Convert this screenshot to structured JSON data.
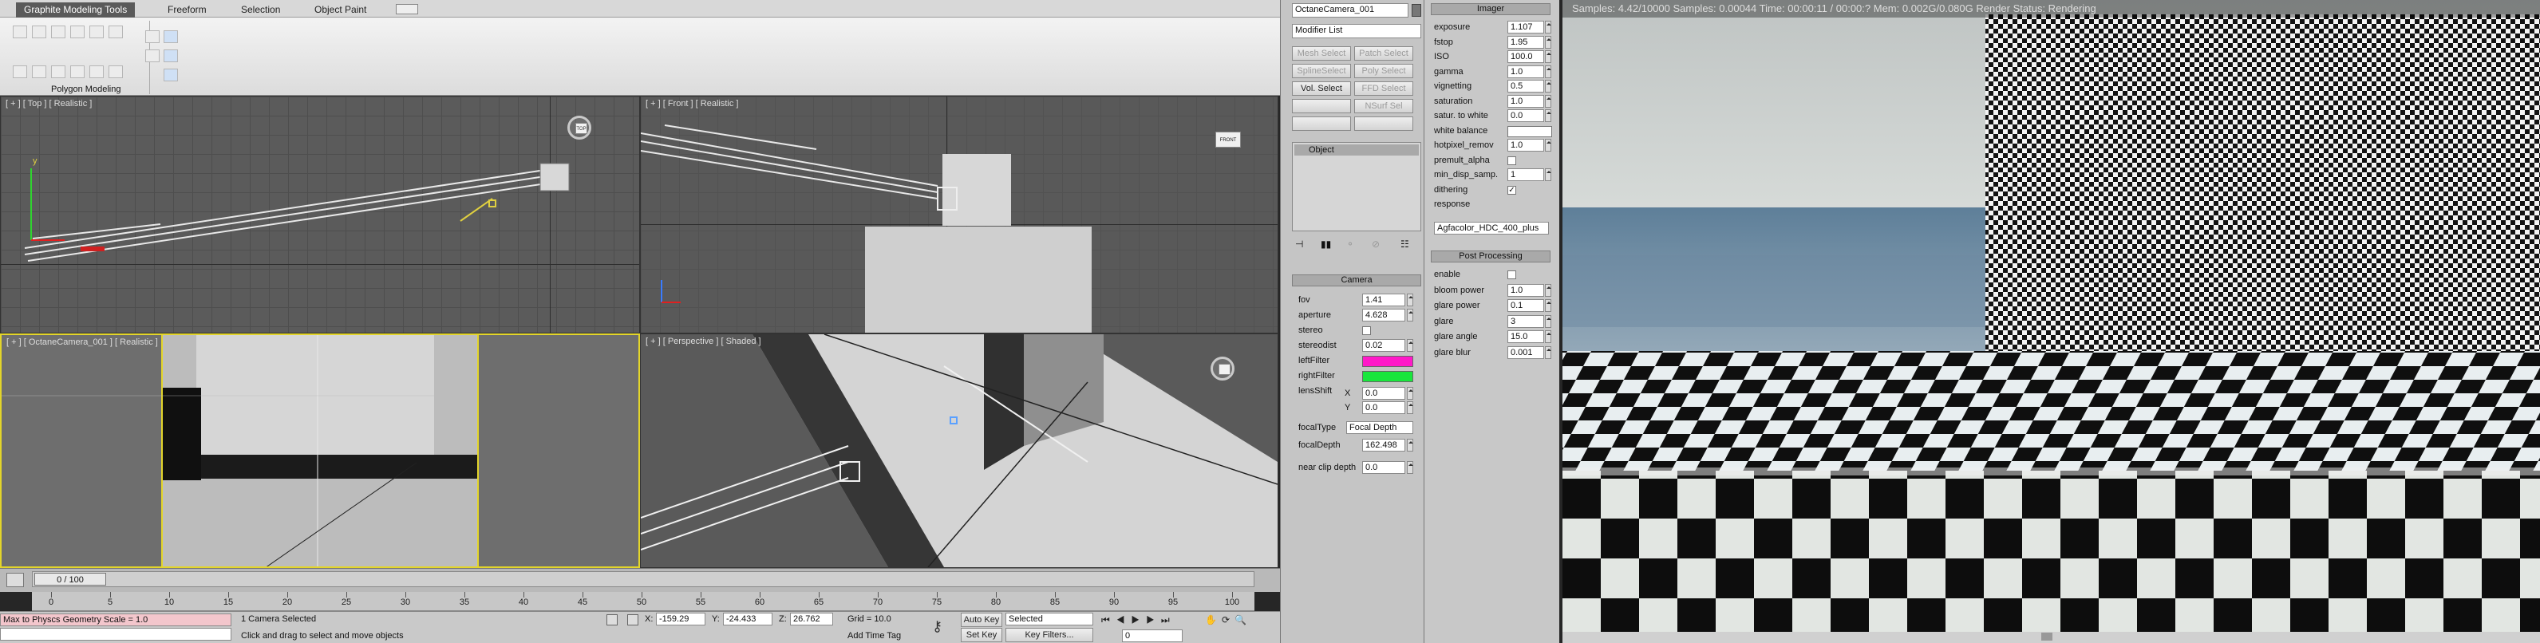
{
  "ribbon": {
    "tabs": [
      "Graphite Modeling Tools",
      "Freeform",
      "Selection",
      "Object Paint"
    ],
    "panel_label": "Polygon Modeling"
  },
  "viewports": {
    "top": "[ + ] [ Top ] [ Realistic ]",
    "front": "[ + ] [ Front ] [ Realistic ]",
    "camera": "[ + ] [ OctaneCamera_001 ] [ Realistic ]",
    "perspective": "[ + ] [ Perspective ] [ Shaded ]",
    "cube_top": "TOP",
    "cube_front": "FRONT",
    "axes": {
      "x": "x",
      "y": "y",
      "z": "z"
    }
  },
  "timeline": {
    "frame_counter": "0 / 100",
    "ticks": [
      "0",
      "5",
      "10",
      "15",
      "20",
      "25",
      "30",
      "35",
      "40",
      "45",
      "50",
      "55",
      "60",
      "65",
      "70",
      "75",
      "80",
      "85",
      "90",
      "95",
      "100"
    ]
  },
  "status": {
    "script_text": "Max to Physcs Geometry Scale = 1.0",
    "selection_text": "1 Camera Selected",
    "prompt_text": "Click and drag to select and move objects",
    "x_label": "X:",
    "x_value": "-159.29",
    "y_label": "Y:",
    "y_value": "-24.433",
    "z_label": "Z:",
    "z_value": "26.762",
    "grid": "Grid = 10.0",
    "add_time_tag": "Add Time Tag",
    "auto_key": "Auto Key",
    "set_key": "Set Key",
    "key_mode": "Selected",
    "key_filters": "Key Filters...",
    "frame_value": "0"
  },
  "command_panel": {
    "object_name": "OctaneCamera_001",
    "modifier_list": "Modifier List",
    "buttons": [
      "Mesh Select",
      "Patch Select",
      "SplineSelect",
      "Poly Select",
      "Vol. Select",
      "FFD Select",
      "",
      "NSurf Sel",
      "",
      ""
    ],
    "stack_item": "Object",
    "camera_rollout": "Camera",
    "params": [
      {
        "label": "fov",
        "value": "1.41"
      },
      {
        "label": "aperture",
        "value": "4.628"
      },
      {
        "label": "stereo",
        "value": ""
      },
      {
        "label": "stereodist",
        "value": "0.02"
      },
      {
        "label": "leftFilter",
        "value": ""
      },
      {
        "label": "rightFilter",
        "value": ""
      },
      {
        "label": "lensShift",
        "value": ""
      }
    ],
    "lens_x_label": "X",
    "lens_x": "0.0",
    "lens_y_label": "Y",
    "lens_y": "0.0",
    "focal_type_label": "focalType",
    "focal_type": "Focal Depth",
    "focal_depth_label": "focalDepth",
    "focal_depth": "162.498",
    "near_clip_label": "near clip depth",
    "near_clip": "0.0",
    "colors": {
      "left_filter": "#ff19c8",
      "right_filter": "#19e63c"
    }
  },
  "imager": {
    "title": "Imager",
    "rows": [
      {
        "label": "exposure",
        "value": "1.107"
      },
      {
        "label": "fstop",
        "value": "1.95"
      },
      {
        "label": "ISO",
        "value": "100.0"
      },
      {
        "label": "gamma",
        "value": "1.0"
      },
      {
        "label": "vignetting",
        "value": "0.5"
      },
      {
        "label": "saturation",
        "value": "1.0"
      },
      {
        "label": "satur. to white",
        "value": "0.0"
      },
      {
        "label": "white balance",
        "value": ""
      },
      {
        "label": "hotpixel_remov",
        "value": "1.0"
      },
      {
        "label": "premult_alpha",
        "value": ""
      },
      {
        "label": "min_disp_samp.",
        "value": "1"
      },
      {
        "label": "dithering",
        "value": "✓"
      },
      {
        "label": "response",
        "value": ""
      }
    ],
    "response_value": "Agfacolor_HDC_400_plus"
  },
  "post_processing": {
    "title": "Post Processing",
    "rows": [
      {
        "label": "enable",
        "value": ""
      },
      {
        "label": "bloom power",
        "value": "1.0"
      },
      {
        "label": "glare power",
        "value": "0.1"
      },
      {
        "label": "glare",
        "value": "3"
      },
      {
        "label": "glare angle",
        "value": "15.0"
      },
      {
        "label": "glare blur",
        "value": "0.001"
      }
    ]
  },
  "render_view": {
    "info": "Samples: 4.42/10000   Samples: 0.00044   Time: 00:00:11 / 00:00:?   Mem: 0.002G/0.080G   Render Status: Rendering"
  }
}
